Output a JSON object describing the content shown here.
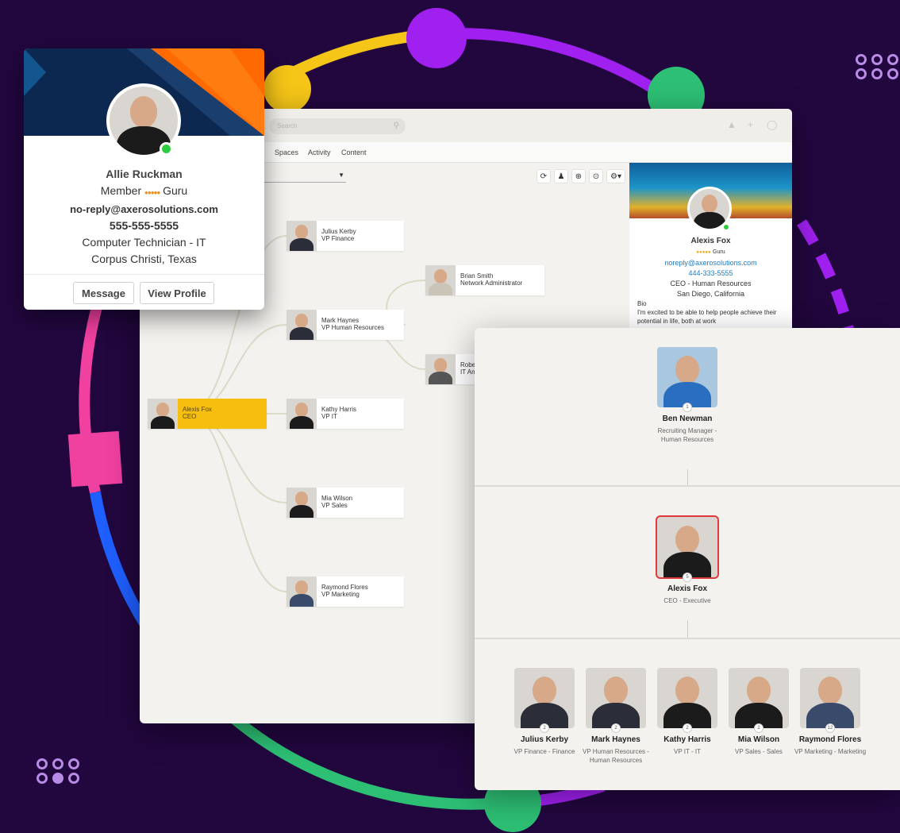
{
  "colors": {
    "background": "#22073f",
    "ring_purple": "#a020f0",
    "ring_yellow": "#f5c518",
    "ring_green": "#2dbf74",
    "ring_pink": "#f040a0",
    "ring_blue": "#1f5fff",
    "ceo_node": "#f6bf0f",
    "online": "#2ecc40"
  },
  "profile_card": {
    "name": "Allie Ruckman",
    "member_label": "Member",
    "rank": "Guru",
    "stars": "●●●●●",
    "email": "no-reply@axerosolutions.com",
    "phone": "555-555-5555",
    "title": "Computer Technician - IT",
    "location": "Corpus Christi, Texas",
    "message_button": "Message",
    "view_profile_button": "View Profile"
  },
  "app": {
    "search_placeholder": "Search",
    "search_icon": "search-icon",
    "nav": [
      "Spaces",
      "Activity",
      "Content"
    ],
    "filter_value": "",
    "tools": [
      "⟳",
      "♟",
      "⊕",
      "⊙",
      "⚙▾"
    ],
    "top_icons": [
      "▲",
      "+",
      "◯"
    ]
  },
  "tree": {
    "ceo": {
      "name": "Alexis Fox",
      "title": "CEO"
    },
    "vps": [
      {
        "name": "Julius Kerby",
        "title": "VP Finance"
      },
      {
        "name": "Mark Haynes",
        "title": "VP Human Resources"
      },
      {
        "name": "Kathy Harris",
        "title": "VP IT"
      },
      {
        "name": "Mia Wilson",
        "title": "VP Sales"
      },
      {
        "name": "Raymond Flores",
        "title": "VP Marketing"
      }
    ],
    "reports": [
      {
        "name": "Brian Smith",
        "title": "Network Administrator"
      },
      {
        "name": "Robe",
        "title": "IT An"
      }
    ]
  },
  "side_profile": {
    "name": "Alexis Fox",
    "stars": "●●●●●",
    "rank": "Guru",
    "email": "noreply@axerosolutions.com",
    "phone": "444-333-5555",
    "title": "CEO - Human Resources",
    "location": "San Diego, California",
    "bio_label": "Bio",
    "bio": "I'm excited to be able to help people achieve their potential in life, both at work"
  },
  "hierarchy": {
    "manager": {
      "name": "Ben Newman",
      "title": "Recruiting Manager - Human Resources",
      "count": "1"
    },
    "selected": {
      "name": "Alexis Fox",
      "title": "CEO - Executive",
      "count": "5"
    },
    "reports": [
      {
        "name": "Julius Kerby",
        "title": "VP Finance - Finance",
        "count": "2"
      },
      {
        "name": "Mark Haynes",
        "title": "VP Human Resources - Human Resources",
        "count": "2"
      },
      {
        "name": "Kathy Harris",
        "title": "VP IT - IT",
        "count": "2"
      },
      {
        "name": "Mia Wilson",
        "title": "VP Sales - Sales",
        "count": "2"
      },
      {
        "name": "Raymond Flores",
        "title": "VP Marketing - Marketing",
        "count": "12"
      }
    ]
  }
}
